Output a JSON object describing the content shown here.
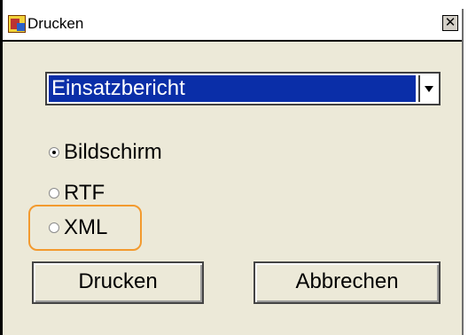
{
  "window": {
    "title": "Drucken",
    "app_icon": "printer-app-icon",
    "close_glyph": "✕"
  },
  "report_select": {
    "selected": "Einsatzbericht"
  },
  "output_options": [
    {
      "label": "Bildschirm",
      "checked": true
    },
    {
      "label": "RTF",
      "checked": false
    },
    {
      "label": "XML",
      "checked": false
    }
  ],
  "highlight_color": "#f39a2e",
  "buttons": {
    "print_label": "Drucken",
    "cancel_label": "Abbrechen"
  }
}
